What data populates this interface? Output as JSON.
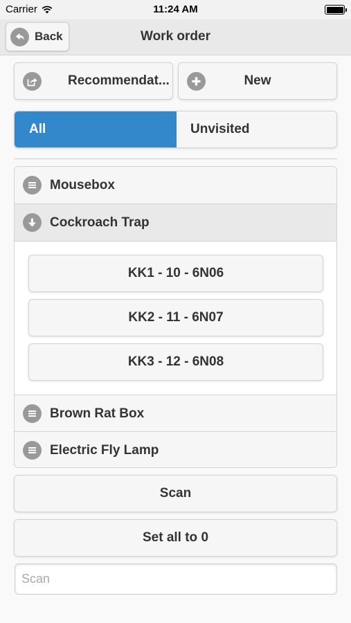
{
  "status_bar": {
    "carrier": "Carrier",
    "time": "11:24 AM"
  },
  "header": {
    "back_label": "Back",
    "title": "Work order"
  },
  "actions": {
    "recommendations_label": "Recommendat...",
    "new_label": "New"
  },
  "filter": {
    "all_label": "All",
    "unvisited_label": "Unvisited",
    "selected": "All",
    "accent_color": "#3388cc"
  },
  "categories": [
    {
      "label": "Mousebox",
      "icon": "list-icon",
      "expanded": false
    },
    {
      "label": "Cockroach Trap",
      "icon": "arrow-down-icon",
      "expanded": true,
      "items": [
        "KK1 - 10 - 6N06",
        "KK2 - 11 - 6N07",
        "KK3 - 12 - 6N08"
      ]
    },
    {
      "label": "Brown Rat Box",
      "icon": "list-icon",
      "expanded": false
    },
    {
      "label": "Electric Fly Lamp",
      "icon": "list-icon",
      "expanded": false
    }
  ],
  "footer": {
    "scan_label": "Scan",
    "set_all_label": "Set all to 0",
    "scan_placeholder": "Scan",
    "scan_value": ""
  }
}
